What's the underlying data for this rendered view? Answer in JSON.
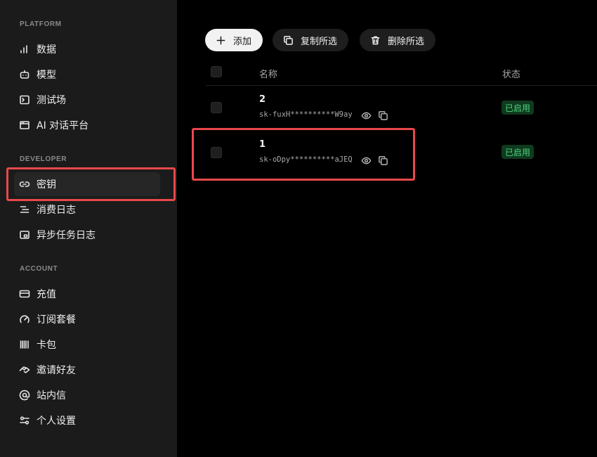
{
  "sidebar": {
    "sections": {
      "platform": "PLATFORM",
      "developer": "DEVELOPER",
      "account": "ACCOUNT"
    },
    "items": {
      "data": "数据",
      "models": "模型",
      "playground": "测试场",
      "ai_chat": "AI 对话平台",
      "keys": "密钥",
      "usage_log": "消费日志",
      "async_log": "异步任务日志",
      "recharge": "充值",
      "subscription": "订阅套餐",
      "cards": "卡包",
      "invite": "邀请好友",
      "inbox": "站内信",
      "settings": "个人设置"
    },
    "active": "keys"
  },
  "toolbar": {
    "add_label": "添加",
    "copy_selected_label": "复制所选",
    "delete_selected_label": "删除所选"
  },
  "table": {
    "headers": {
      "name": "名称",
      "status": "状态"
    },
    "rows": [
      {
        "name": "2",
        "key": "sk-fuxH**********W9ay",
        "status": "已启用"
      },
      {
        "name": "1",
        "key": "sk-oDpy**********aJEQ",
        "status": "已启用"
      }
    ]
  },
  "colors": {
    "highlight": "#e8484b",
    "status_text": "#4cd37c",
    "status_bg": "#0f3a1e",
    "sidebar_bg": "#1b1b1b",
    "main_bg": "#000000"
  }
}
